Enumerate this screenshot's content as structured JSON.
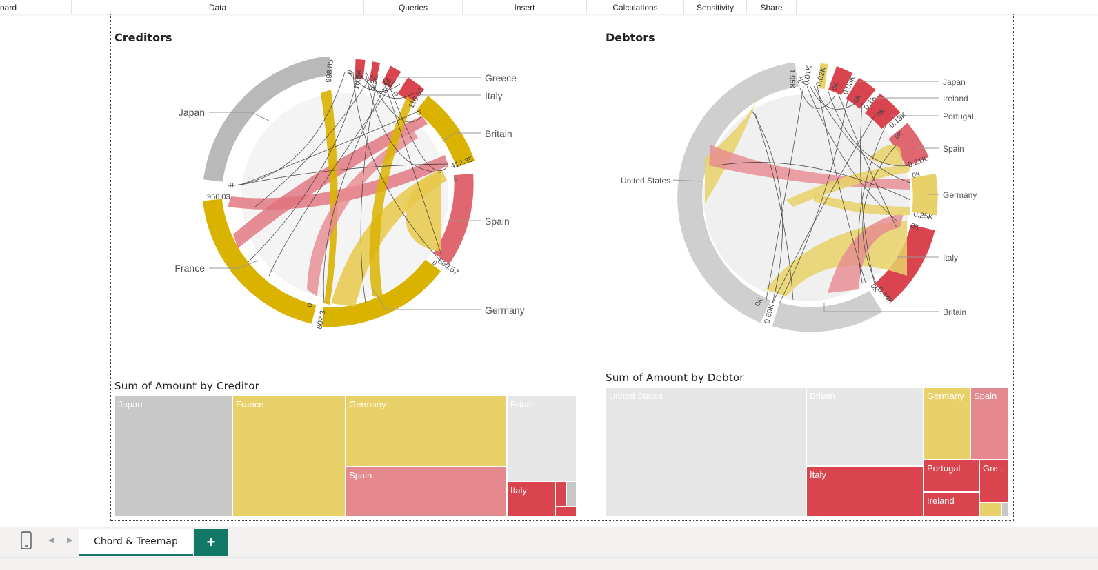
{
  "ribbon": {
    "tabs": [
      "oard",
      "Data",
      "Queries",
      "Insert",
      "Calculations",
      "Sensitivity",
      "Share"
    ]
  },
  "colors": {
    "gray": "#c8c8c8",
    "lightgray": "#e6e6e6",
    "gold": "#d9b300",
    "yellow": "#e8d169",
    "red": "#d9444f",
    "pink": "#e6898f",
    "accent": "#117865"
  },
  "creditors": {
    "title": "Creditors",
    "labels": [
      "Greece",
      "Italy",
      "Japan",
      "Britain",
      "Spain",
      "France",
      "Germany"
    ],
    "ticks": [
      "998.85",
      "0",
      "10.59",
      "6.36",
      "4.72",
      "0",
      "116.92",
      "0",
      "412.35",
      "0",
      "0",
      "956.03",
      "0",
      "560.57",
      "0",
      "802.3"
    ]
  },
  "debtors": {
    "title": "Debtors",
    "labels": [
      "Japan",
      "Ireland",
      "Portugal",
      "Spain",
      "United States",
      "Germany",
      "Italy",
      "Britain"
    ],
    "ticks": [
      "1.95K",
      "0K",
      "0.01K",
      "0.02K",
      "0K",
      "0.03K",
      "0K",
      "0.1K",
      "0K",
      "0.13K",
      "0K",
      "0.21K",
      "0K",
      "0.25K",
      "0K",
      "0.44K",
      "0K",
      "0K",
      "0.69K"
    ]
  },
  "treemap_creditor": {
    "title": "Sum of Amount by Creditor",
    "cells": [
      "Japan",
      "France",
      "Germany",
      "Britain",
      "Spain",
      "Italy"
    ]
  },
  "treemap_debtor": {
    "title": "Sum of Amount by Debtor",
    "cells": [
      "United States",
      "Britain",
      "Germany",
      "Spain",
      "Italy",
      "Portugal",
      "Gre...",
      "Ireland"
    ]
  },
  "pages": {
    "active": "Chord & Treemap",
    "add": "+"
  }
}
